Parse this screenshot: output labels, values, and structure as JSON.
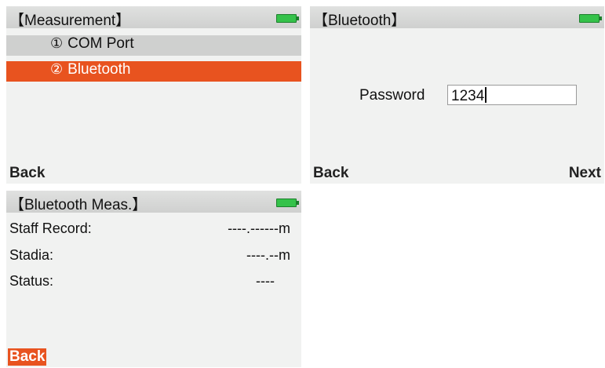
{
  "screens": {
    "measurement": {
      "title": "【Measurement】",
      "items": [
        {
          "num": "①",
          "label": "COM Port"
        },
        {
          "num": "②",
          "label": "Bluetooth"
        }
      ],
      "left_softkey": "Back"
    },
    "bluetooth": {
      "title": "【Bluetooth】",
      "password_label": "Password",
      "password_value": "1234",
      "left_softkey": "Back",
      "right_softkey": "Next"
    },
    "bluetooth_meas": {
      "title": "【Bluetooth Meas.】",
      "rows": [
        {
          "label": "Staff Record:",
          "value": "----.------m"
        },
        {
          "label": "Stadia:",
          "value": "----.--m"
        },
        {
          "label": "Status:",
          "value": "----"
        }
      ],
      "left_softkey": "Back"
    }
  },
  "colors": {
    "accent": "#e8531f",
    "titlebar": "#d6d7d6",
    "screen_bg": "#f1f2f1",
    "battery": "#35c24a"
  },
  "icons": {
    "battery": "battery-icon"
  }
}
